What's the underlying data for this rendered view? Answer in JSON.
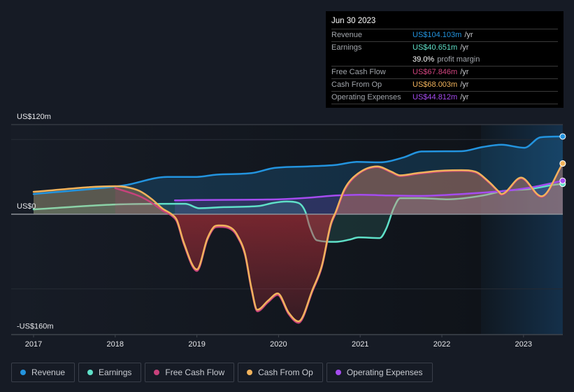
{
  "tooltip": {
    "date": "Jun 30 2023",
    "rows": [
      {
        "label": "Revenue",
        "value": "US$104.103m",
        "suffix": "/yr",
        "color": "#2394df"
      },
      {
        "label": "Earnings",
        "value": "US$40.651m",
        "suffix": "/yr",
        "color": "#5fe0c8"
      },
      {
        "label": "",
        "value": "39.0%",
        "suffix": "profit margin",
        "color": "#ffffff"
      },
      {
        "label": "Free Cash Flow",
        "value": "US$67.846m",
        "suffix": "/yr",
        "color": "#d2457f"
      },
      {
        "label": "Cash From Op",
        "value": "US$68.003m",
        "suffix": "/yr",
        "color": "#f1b35c"
      },
      {
        "label": "Operating Expenses",
        "value": "US$44.812m",
        "suffix": "/yr",
        "color": "#a54cf0"
      }
    ]
  },
  "legend": [
    {
      "label": "Revenue",
      "color": "#2394df"
    },
    {
      "label": "Earnings",
      "color": "#5fe0c8"
    },
    {
      "label": "Free Cash Flow",
      "color": "#c8427c"
    },
    {
      "label": "Cash From Op",
      "color": "#f1b35c"
    },
    {
      "label": "Operating Expenses",
      "color": "#a54cf0"
    }
  ],
  "chart_data": {
    "type": "area",
    "title": "",
    "xlabel": "",
    "ylabel": "",
    "units": "US$ millions",
    "xlim": [
      2016.73,
      2023.48
    ],
    "ylim": [
      -160,
      120
    ],
    "x_ticks": [
      {
        "value": 2017,
        "label": "2017"
      },
      {
        "value": 2018,
        "label": "2018"
      },
      {
        "value": 2019,
        "label": "2019"
      },
      {
        "value": 2020,
        "label": "2020"
      },
      {
        "value": 2021,
        "label": "2021"
      },
      {
        "value": 2022,
        "label": "2022"
      },
      {
        "value": 2023,
        "label": "2023"
      }
    ],
    "y_ticks": [
      {
        "value": 120,
        "label": "US$120m"
      },
      {
        "value": 0,
        "label": "US$0"
      },
      {
        "value": -160,
        "label": "-US$160m"
      }
    ],
    "gridlines": [
      120,
      100,
      -100
    ],
    "grid": true,
    "legend_position": "bottom-left",
    "highlight_range": [
      2022.48,
      2023.48
    ],
    "series": [
      {
        "name": "Revenue",
        "color": "#2394df",
        "points": [
          [
            2017.0,
            27
          ],
          [
            2018.0,
            37
          ],
          [
            2018.13,
            39
          ],
          [
            2018.64,
            50
          ],
          [
            2019.0,
            50
          ],
          [
            2019.24,
            53
          ],
          [
            2019.67,
            55
          ],
          [
            2019.95,
            62
          ],
          [
            2020.36,
            64
          ],
          [
            2020.7,
            66
          ],
          [
            2020.96,
            70
          ],
          [
            2021.24,
            69.5
          ],
          [
            2021.53,
            76
          ],
          [
            2021.75,
            84
          ],
          [
            2022.24,
            84.4
          ],
          [
            2022.5,
            90
          ],
          [
            2022.73,
            93
          ],
          [
            2023.01,
            89
          ],
          [
            2023.21,
            103
          ],
          [
            2023.48,
            104.103
          ]
        ]
      },
      {
        "name": "Earnings",
        "color": "#5fe0c8",
        "points": [
          [
            2017.0,
            6.5
          ],
          [
            2018.0,
            13
          ],
          [
            2018.73,
            14
          ],
          [
            2018.86,
            14
          ],
          [
            2019.03,
            8
          ],
          [
            2019.33,
            9.5
          ],
          [
            2019.76,
            11
          ],
          [
            2019.93,
            15
          ],
          [
            2020.1,
            17
          ],
          [
            2020.245,
            15
          ],
          [
            2020.33,
            3
          ],
          [
            2020.38,
            -16
          ],
          [
            2020.47,
            -35
          ],
          [
            2020.7,
            -37
          ],
          [
            2020.87,
            -34
          ],
          [
            2020.98,
            -31
          ],
          [
            2021.24,
            -32
          ],
          [
            2021.32,
            -19
          ],
          [
            2021.41,
            8
          ],
          [
            2021.49,
            21.5
          ],
          [
            2021.73,
            21.5
          ],
          [
            2022.07,
            20
          ],
          [
            2022.5,
            25
          ],
          [
            2022.75,
            31
          ],
          [
            2023.1,
            34
          ],
          [
            2023.35,
            39
          ],
          [
            2023.48,
            40.651
          ]
        ]
      },
      {
        "name": "Free Cash Flow",
        "color": "#c8427c",
        "points": [
          [
            2018.0,
            35
          ],
          [
            2018.3,
            24
          ],
          [
            2018.45,
            15
          ],
          [
            2018.58,
            5
          ],
          [
            2018.69,
            -2
          ],
          [
            2018.755,
            -10
          ],
          [
            2018.84,
            -40
          ],
          [
            2019.0,
            -76
          ],
          [
            2019.13,
            -34
          ],
          [
            2019.22,
            -18
          ],
          [
            2019.27,
            -17
          ],
          [
            2019.44,
            -22
          ],
          [
            2019.5,
            -31
          ],
          [
            2019.59,
            -55
          ],
          [
            2019.67,
            -102
          ],
          [
            2019.74,
            -130
          ],
          [
            2019.87,
            -118
          ],
          [
            2019.99,
            -108
          ],
          [
            2020.125,
            -134
          ],
          [
            2020.245,
            -145.5
          ],
          [
            2020.42,
            -102
          ],
          [
            2020.53,
            -71
          ],
          [
            2020.64,
            -15
          ],
          [
            2020.7,
            1
          ],
          [
            2020.81,
            32
          ],
          [
            2020.98,
            54
          ],
          [
            2021.21,
            63
          ],
          [
            2021.38,
            56
          ],
          [
            2021.49,
            51
          ],
          [
            2021.7,
            54
          ],
          [
            2021.96,
            57
          ],
          [
            2022.24,
            58
          ],
          [
            2022.41,
            56
          ],
          [
            2022.58,
            42
          ],
          [
            2022.69,
            30
          ],
          [
            2022.73,
            26
          ],
          [
            2022.97,
            48
          ],
          [
            2023.22,
            23
          ],
          [
            2023.48,
            67.846
          ]
        ]
      },
      {
        "name": "Cash From Op",
        "color": "#f1b35c",
        "points": [
          [
            2017.0,
            30
          ],
          [
            2018.0,
            37.5
          ],
          [
            2018.13,
            36.5
          ],
          [
            2018.3,
            31
          ],
          [
            2018.45,
            20
          ],
          [
            2018.58,
            7.5
          ],
          [
            2018.69,
            0
          ],
          [
            2018.755,
            -8
          ],
          [
            2018.84,
            -38
          ],
          [
            2019.0,
            -74
          ],
          [
            2019.13,
            -32
          ],
          [
            2019.22,
            -16
          ],
          [
            2019.27,
            -15
          ],
          [
            2019.44,
            -20
          ],
          [
            2019.5,
            -29
          ],
          [
            2019.59,
            -53
          ],
          [
            2019.67,
            -100
          ],
          [
            2019.74,
            -128
          ],
          [
            2019.87,
            -116
          ],
          [
            2019.99,
            -106
          ],
          [
            2020.125,
            -132
          ],
          [
            2020.245,
            -143.5
          ],
          [
            2020.42,
            -100
          ],
          [
            2020.53,
            -69
          ],
          [
            2020.64,
            -13
          ],
          [
            2020.7,
            3
          ],
          [
            2020.81,
            34
          ],
          [
            2020.98,
            55
          ],
          [
            2021.21,
            64
          ],
          [
            2021.38,
            57
          ],
          [
            2021.49,
            52
          ],
          [
            2021.7,
            55
          ],
          [
            2021.96,
            58
          ],
          [
            2022.24,
            59
          ],
          [
            2022.41,
            57
          ],
          [
            2022.58,
            43
          ],
          [
            2022.69,
            31
          ],
          [
            2022.73,
            27
          ],
          [
            2022.97,
            49
          ],
          [
            2023.22,
            24
          ],
          [
            2023.48,
            68.003
          ]
        ]
      },
      {
        "name": "Operating Expenses",
        "color": "#a54cf0",
        "points": [
          [
            2018.73,
            18.5
          ],
          [
            2019.0,
            19
          ],
          [
            2020.0,
            20
          ],
          [
            2020.36,
            22
          ],
          [
            2020.7,
            25
          ],
          [
            2021.0,
            26
          ],
          [
            2021.38,
            25
          ],
          [
            2021.73,
            24.5
          ],
          [
            2022.24,
            27
          ],
          [
            2022.75,
            31
          ],
          [
            2023.1,
            36
          ],
          [
            2023.48,
            44.812
          ]
        ]
      }
    ]
  }
}
